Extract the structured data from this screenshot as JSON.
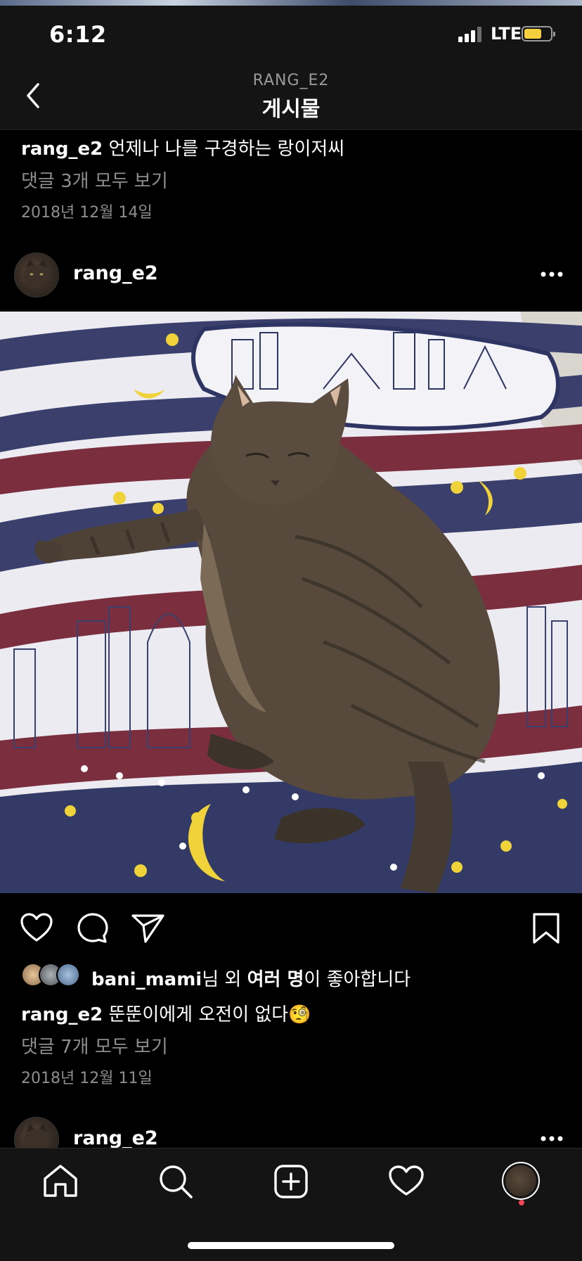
{
  "status": {
    "time": "6:12",
    "network": "LTE"
  },
  "nav": {
    "subtitle": "RANG_E2",
    "title": "게시물"
  },
  "prev_post": {
    "username": "rang_e2",
    "caption": "언제나 나를 구경하는 랑이저씨",
    "comments_link": "댓글 3개 모두 보기",
    "date": "2018년 12월 14일"
  },
  "post": {
    "username": "rang_e2",
    "likes": {
      "user": "bani_mami",
      "suffix1": "님 외 ",
      "others": "여러 명",
      "suffix2": "이 좋아합니다"
    },
    "caption_user": "rang_e2",
    "caption": "뚠뚠이에게 오전이 없다",
    "caption_emoji": "🧐",
    "comments_link": "댓글 7개 모두 보기",
    "date": "2018년 12월 11일"
  },
  "next_post": {
    "username": "rang_e2"
  },
  "icons": {
    "back": "chevron-left-icon",
    "more": "more-horizontal-icon",
    "like": "heart-icon",
    "comment": "comment-icon",
    "share": "paper-plane-icon",
    "save": "bookmark-icon",
    "tabs": [
      "home-icon",
      "search-icon",
      "add-post-icon",
      "activity-heart-icon",
      "profile-avatar-icon"
    ]
  },
  "colors": {
    "background": "#000000",
    "bar": "#141414",
    "secondary_text": "#8e8e8e",
    "notification_dot": "#ed4956",
    "battery": "#f4d03f"
  }
}
